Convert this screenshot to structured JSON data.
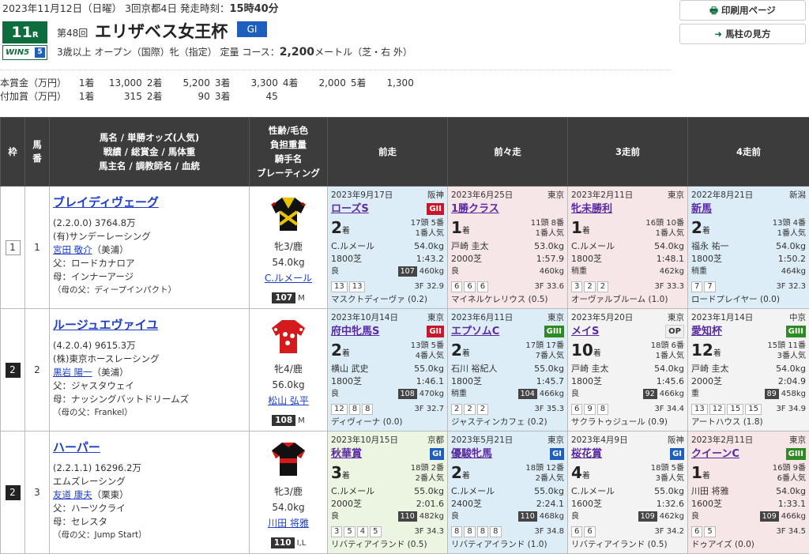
{
  "header": {
    "date": "2023年11月12日（日曜） 3回京都4日 発走時刻：",
    "post_time": "15時40分",
    "race_number": "11",
    "race_unit": "R",
    "win5_label": "WIN5",
    "win5_num": "5",
    "kai": "第48回",
    "race_name": "エリザベス女王杯",
    "grade": "GI",
    "conditions": "3歳以上 オープン（国際）牝（指定） 定量 コース：",
    "distance": "2,200",
    "course_suffix": "メートル（芝・右 外）",
    "print_button": "印刷用ページ",
    "howto_button": "馬柱の見方"
  },
  "prize": {
    "main_label": "本賞金（万円）",
    "main": [
      [
        "1着",
        "13,000"
      ],
      [
        "2着",
        "5,200"
      ],
      [
        "3着",
        "3,300"
      ],
      [
        "4着",
        "2,000"
      ],
      [
        "5着",
        "1,300"
      ]
    ],
    "extra_label": "付加賞（万円）",
    "extra": [
      [
        "1着",
        "315"
      ],
      [
        "2着",
        "90"
      ],
      [
        "3着",
        "45"
      ]
    ]
  },
  "columns": {
    "waku": "枠",
    "umaban": "馬番",
    "horse_l1": "馬名 / 単勝オッズ(人気)",
    "horse_l2": "戦績 / 総賞金 / 馬体重",
    "horse_l3": "馬主名 / 調教師名 / 血統",
    "jockey_l1": "性齢/毛色",
    "jockey_l2": "負担重量",
    "jockey_l3": "騎手名",
    "jockey_l4": "ブレーティング",
    "prev1": "前走",
    "prev2": "前々走",
    "prev3": "3走前",
    "prev4": "4走前"
  },
  "colors": {
    "frame1": "#ffffff",
    "frame2": "#222222",
    "green": "#0e6d3c"
  },
  "horses": [
    {
      "waku": "1",
      "umaban": "1",
      "name": "ブレイディヴェーグ",
      "record": "(2.2.0.0)",
      "money": "3764.8万",
      "owner": "(有)サンデーレーシング",
      "trainer": "宮田 敬介",
      "stable": "（美浦）",
      "sire": "父：ロードカナロア",
      "dam": "母：インナーアージ",
      "damsire": "（母の父：ディープインパクト）",
      "sex_age": "牝3/鹿",
      "weight": "54.0kg",
      "jockey": "C.ルメール",
      "rating": "107",
      "rating_tag": "M",
      "past": [
        {
          "date": "2023年9月17日",
          "venue": "阪神",
          "race": "ローズS",
          "grade": "GII",
          "gclass": "g2",
          "pos": "2",
          "field": "17頭 5番",
          "pop": "1番人気",
          "jockey": "C.ルメール",
          "kg": "54.0kg",
          "dist": "1800芝",
          "time": "1:43.2",
          "track": "良",
          "bw": "107",
          "hw": "460kg",
          "corners": [
            "13",
            "13"
          ],
          "f3": "3F 32.9",
          "winner": "マスクトディーヴァ (0.2)"
        },
        {
          "date": "2023年6月25日",
          "venue": "東京",
          "race": "1勝クラス",
          "grade": "",
          "gclass": "",
          "pos": "1",
          "field": "11頭 8番",
          "pop": "1番人気",
          "jockey": "戸崎 圭太",
          "kg": "53.0kg",
          "dist": "2000芝",
          "time": "1:57.9",
          "track": "良",
          "bw": "",
          "hw": "460kg",
          "corners": [
            "6",
            "6",
            "6"
          ],
          "f3": "3F 33.6",
          "winner": "マイネルケレリウス (0.5)"
        },
        {
          "date": "2023年2月11日",
          "venue": "東京",
          "race": "牝未勝利",
          "grade": "",
          "gclass": "",
          "pos": "1",
          "field": "16頭 10番",
          "pop": "1番人気",
          "jockey": "C.ルメール",
          "kg": "54.0kg",
          "dist": "1800芝",
          "time": "1:48.1",
          "track": "稍重",
          "bw": "",
          "hw": "462kg",
          "corners": [
            "3",
            "2",
            "2"
          ],
          "f3": "3F 33.3",
          "winner": "オーヴァルブルーム (1.0)"
        },
        {
          "date": "2022年8月21日",
          "venue": "新潟",
          "race": "新馬",
          "grade": "",
          "gclass": "",
          "pos": "2",
          "field": "13頭 4番",
          "pop": "1番人気",
          "jockey": "福永 祐一",
          "kg": "54.0kg",
          "dist": "1800芝",
          "time": "1:50.2",
          "track": "稍重",
          "bw": "",
          "hw": "464kg",
          "corners": [
            "7",
            "7"
          ],
          "f3": "3F 32.3",
          "winner": "ロードプレイヤー (0.0)"
        }
      ]
    },
    {
      "waku": "2",
      "umaban": "2",
      "name": "ルージュエヴァイユ",
      "record": "(4.2.0.4)",
      "money": "9615.3万",
      "owner": "(株)東京ホースレーシング",
      "trainer": "黒岩 陽一",
      "stable": "（美浦）",
      "sire": "父：ジャスタウェイ",
      "dam": "母：ナッシングバットドリームズ",
      "damsire": "（母の父：Frankel）",
      "sex_age": "牝4/鹿",
      "weight": "56.0kg",
      "jockey": "松山 弘平",
      "rating": "108",
      "rating_tag": "M",
      "past": [
        {
          "date": "2023年10月14日",
          "venue": "東京",
          "race": "府中牝馬S",
          "grade": "GII",
          "gclass": "g2",
          "pos": "2",
          "field": "13頭 5番",
          "pop": "4番人気",
          "jockey": "横山 武史",
          "kg": "55.0kg",
          "dist": "1800芝",
          "time": "1:46.1",
          "track": "良",
          "bw": "108",
          "hw": "470kg",
          "corners": [
            "12",
            "8",
            "8"
          ],
          "f3": "3F 32.7",
          "winner": "ディヴィーナ (0.0)"
        },
        {
          "date": "2023年6月11日",
          "venue": "東京",
          "race": "エプソムC",
          "grade": "GIII",
          "gclass": "g3",
          "pos": "2",
          "field": "17頭 17番",
          "pop": "7番人気",
          "jockey": "石川 裕紀人",
          "kg": "55.0kg",
          "dist": "1800芝",
          "time": "1:45.7",
          "track": "稍重",
          "bw": "104",
          "hw": "466kg",
          "corners": [
            "2",
            "2",
            "2"
          ],
          "f3": "3F 35.3",
          "winner": "ジャスティンカフェ (0.2)"
        },
        {
          "date": "2023年5月20日",
          "venue": "東京",
          "race": "メイS",
          "grade": "OP",
          "gclass": "op",
          "pos": "10",
          "field": "18頭 6番",
          "pop": "1番人気",
          "jockey": "戸崎 圭太",
          "kg": "54.0kg",
          "dist": "1800芝",
          "time": "1:45.6",
          "track": "良",
          "bw": "92",
          "hw": "466kg",
          "corners": [
            "6",
            "9",
            "8"
          ],
          "f3": "3F 34.4",
          "winner": "サクラトゥジュール (0.9)"
        },
        {
          "date": "2023年1月14日",
          "venue": "中京",
          "race": "愛知杯",
          "grade": "GIII",
          "gclass": "g3",
          "pos": "12",
          "field": "15頭 11番",
          "pop": "3番人気",
          "jockey": "戸崎 圭太",
          "kg": "54.0kg",
          "dist": "2000芝",
          "time": "2:04.9",
          "track": "重",
          "bw": "89",
          "hw": "458kg",
          "corners": [
            "13",
            "12",
            "15",
            "15"
          ],
          "f3": "3F 34.9",
          "winner": "アートハウス (1.8)"
        }
      ]
    },
    {
      "waku": "2",
      "umaban": "3",
      "name": "ハーパー",
      "record": "(2.2.1.1)",
      "money": "16296.2万",
      "owner": "エムズレーシング",
      "trainer": "友道 康夫",
      "stable": "（栗東）",
      "sire": "父：ハーツクライ",
      "dam": "母：セレスタ",
      "damsire": "（母の父：Jump Start）",
      "sex_age": "牝3/鹿",
      "weight": "54.0kg",
      "jockey": "川田 将雅",
      "rating": "110",
      "rating_tag": "I,L",
      "past": [
        {
          "date": "2023年10月15日",
          "venue": "京都",
          "race": "秋華賞",
          "grade": "GI",
          "gclass": "g1",
          "pos": "3",
          "field": "18頭 2番",
          "pop": "2番人気",
          "jockey": "C.ルメール",
          "kg": "55.0kg",
          "dist": "2000芝",
          "time": "2:01.6",
          "track": "良",
          "bw": "110",
          "hw": "482kg",
          "corners": [
            "3",
            "5",
            "4",
            "5"
          ],
          "f3": "3F 34.3",
          "winner": "リバティアイランド (0.5)"
        },
        {
          "date": "2023年5月21日",
          "venue": "東京",
          "race": "優駿牝馬",
          "grade": "GI",
          "gclass": "g1",
          "pos": "2",
          "field": "18頭 12番",
          "pop": "2番人気",
          "jockey": "C.ルメール",
          "kg": "55.0kg",
          "dist": "2400芝",
          "time": "2:24.1",
          "track": "良",
          "bw": "110",
          "hw": "468kg",
          "corners": [
            "8",
            "8",
            "8",
            "8"
          ],
          "f3": "3F 34.8",
          "winner": "リバティアイランド (1.0)"
        },
        {
          "date": "2023年4月9日",
          "venue": "阪神",
          "race": "桜花賞",
          "grade": "GI",
          "gclass": "g1",
          "pos": "4",
          "field": "18頭 5番",
          "pop": "3番人気",
          "jockey": "C.ルメール",
          "kg": "55.0kg",
          "dist": "1600芝",
          "time": "1:32.6",
          "track": "良",
          "bw": "109",
          "hw": "462kg",
          "corners": [
            "6",
            "6"
          ],
          "f3": "3F 34.2",
          "winner": "リバティアイランド (0.5)"
        },
        {
          "date": "2023年2月11日",
          "venue": "東京",
          "race": "クイーンC",
          "grade": "GIII",
          "gclass": "g3",
          "pos": "1",
          "field": "16頭 9番",
          "pop": "6番人気",
          "jockey": "川田 将雅",
          "kg": "54.0kg",
          "dist": "1600芝",
          "time": "1:33.1",
          "track": "良",
          "bw": "109",
          "hw": "466kg",
          "corners": [
            "6",
            "5"
          ],
          "f3": "3F 34.5",
          "winner": "ドゥアイズ (0.0)"
        }
      ]
    }
  ]
}
